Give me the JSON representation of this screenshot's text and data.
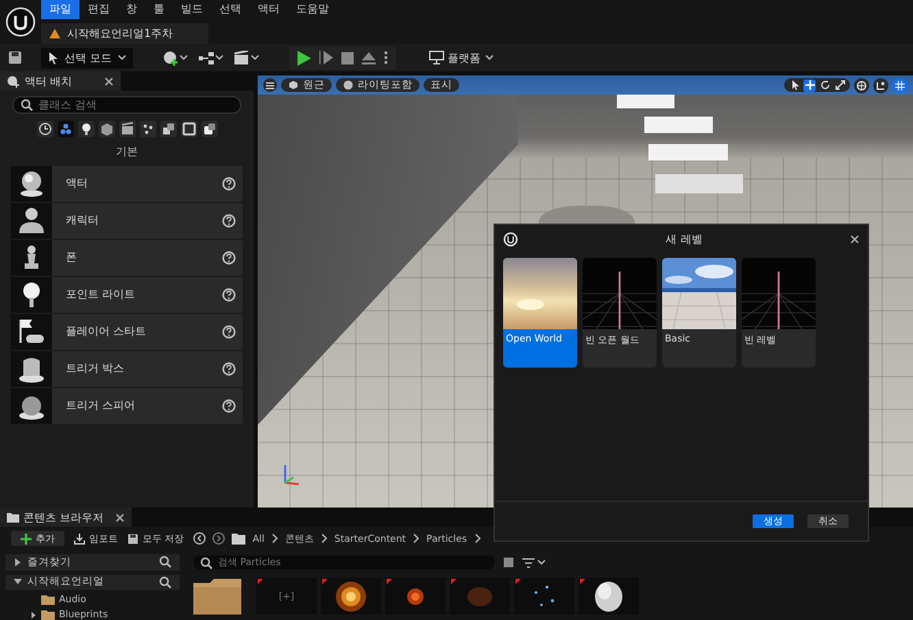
{
  "menu": [
    {
      "label": "파일",
      "selected": true
    },
    {
      "label": "편집",
      "selected": false
    },
    {
      "label": "창",
      "selected": false
    },
    {
      "label": "툴",
      "selected": false
    },
    {
      "label": "빌드",
      "selected": false
    },
    {
      "label": "선택",
      "selected": false
    },
    {
      "label": "액터",
      "selected": false
    },
    {
      "label": "도움말",
      "selected": false
    }
  ],
  "project_tab": {
    "title": "시작해요언리얼1주차"
  },
  "toolbar": {
    "mode_button": "선택 모드",
    "platforms_button": "플랫폼"
  },
  "place_actors": {
    "title": "액터 배치",
    "search": {
      "placeholder": "클래스 검색"
    },
    "filters": [
      {
        "selected": false
      },
      {
        "selected": true
      },
      {
        "selected": false
      },
      {
        "selected": false
      },
      {
        "selected": false
      },
      {
        "selected": false
      },
      {
        "selected": false
      },
      {
        "selected": false
      },
      {
        "selected": false
      }
    ],
    "category": "기본",
    "items": [
      {
        "label": "액터"
      },
      {
        "label": "캐릭터"
      },
      {
        "label": "폰"
      },
      {
        "label": "포인트 라이트"
      },
      {
        "label": "플레이어 스타트"
      },
      {
        "label": "트리거 박스"
      },
      {
        "label": "트리거 스피어"
      }
    ]
  },
  "viewport": {
    "buttons": [
      "원근",
      "라이팅포함",
      "표시"
    ],
    "transform_tools": [
      {
        "selected": false
      },
      {
        "selected": true
      },
      {
        "selected": false
      },
      {
        "selected": false
      }
    ]
  },
  "new_level_dialog": {
    "title": "새 레벨",
    "templates": [
      {
        "label": "Open World",
        "selected": true,
        "kind": "sunset"
      },
      {
        "label": "빈 오픈 월드",
        "selected": false,
        "kind": "grid"
      },
      {
        "label": "Basic",
        "selected": false,
        "kind": "sky"
      },
      {
        "label": "빈 레벨",
        "selected": false,
        "kind": "grid"
      }
    ],
    "buttons": [
      {
        "label": "생성",
        "kind": "primary"
      },
      {
        "label": "취소",
        "kind": "secondary"
      }
    ]
  },
  "content_browser": {
    "title": "콘텐츠 브라우저",
    "actions": [
      "추가",
      "임포트",
      "모두 저장"
    ],
    "breadcrumb": [
      "All",
      "콘텐츠",
      "StarterContent",
      "Particles"
    ],
    "sources": [
      {
        "label": "즐겨찾기",
        "expanded": false
      },
      {
        "label": "시작해요언리얼",
        "expanded": true
      }
    ],
    "folders": [
      {
        "label": "Audio",
        "expanded": false
      },
      {
        "label": "Blueprints",
        "expanded": false
      }
    ],
    "search": {
      "placeholder": "검색 Particles"
    },
    "assets": [
      {
        "kind": "folder"
      },
      {
        "kind": "empty",
        "label": "[+]"
      },
      {
        "kind": "fire"
      },
      {
        "kind": "ember"
      },
      {
        "kind": "dark-smoke"
      },
      {
        "kind": "sparks"
      },
      {
        "kind": "smoke"
      }
    ]
  }
}
